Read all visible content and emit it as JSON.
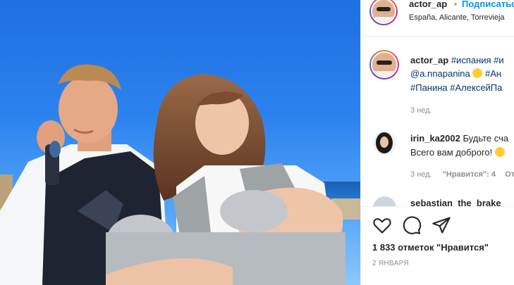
{
  "post": {
    "author": "actor_ap",
    "separator": "•",
    "follow_label": "Подписаться",
    "location": "España, Alicante, Torrevieja"
  },
  "caption": {
    "author": "actor_ap",
    "line1_tags": "#испания #и",
    "line2_mention": "@a.nnapanina",
    "line2_tags": "#Ан",
    "line3_tags": "#Панина #АлексейПа",
    "time": "3 нед."
  },
  "comments": [
    {
      "author": "irin_ka2002",
      "text_line1": "Будьте сча",
      "text_line2": "Всего вам доброго!",
      "time": "3 нед.",
      "likes_label": "\"Нравится\": 4",
      "reply_label": "От"
    },
    {
      "author": "sebastian_the_brake"
    }
  ],
  "actions": {
    "like_icon": "heart-icon",
    "comment_icon": "comment-icon",
    "share_icon": "paper-plane-icon"
  },
  "likes_text": "1 833 отметок \"Нравится\"",
  "date_text": "2 ЯНВАРЯ",
  "colors": {
    "accent": "#0095f6",
    "text": "#262626",
    "muted": "#8e8e8e",
    "tag": "#00376b",
    "sky": "#2b82ee"
  }
}
